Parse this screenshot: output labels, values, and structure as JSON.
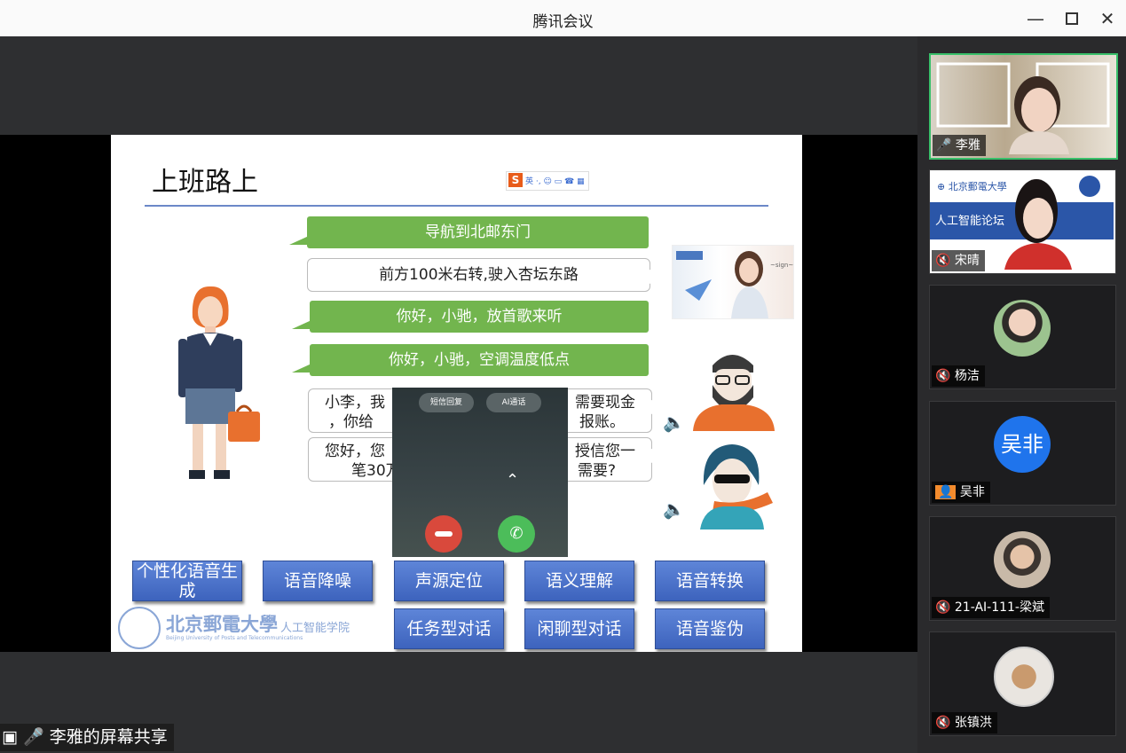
{
  "window": {
    "title": "腾讯会议"
  },
  "slide": {
    "title": "上班路上",
    "bubbles": [
      "导航到北邮东门",
      "前方100米右转,驶入杏坛东路",
      "你好，小驰，放首歌来听",
      "你好，小驰，空调温度低点",
      "小李，我",
      "需要现金",
      "，你给",
      "报账。",
      "您好，您",
      "授信您一",
      "笔30万",
      "需要?"
    ],
    "buttons": [
      "个性化语音生成",
      "语音降噪",
      "声源定位",
      "语义理解",
      "语音转换",
      "任务型对话",
      "闲聊型对话",
      "语音鉴伪"
    ],
    "university_cn": "北京郵電大學",
    "university_en": "Beijing University of Posts and Telecommunications",
    "school": "人工智能学院"
  },
  "call": {
    "sms_reply": "短信回复",
    "ai_call": "AI通话"
  },
  "share_label": "李雅的屏幕共享",
  "participants": [
    {
      "name": "李雅"
    },
    {
      "name": "宋晴",
      "banner": "人工智能论坛"
    },
    {
      "name": "杨洁"
    },
    {
      "name": "吴非",
      "avatar_text": "吴非"
    },
    {
      "name": "21-AI-111-梁斌"
    },
    {
      "name": "张镇洪"
    }
  ],
  "colors": {
    "accent_green": "#39c06a",
    "avatar_blue": "#1f74ec",
    "slide_green": "#72b54e",
    "button_blue": "#4a70c8"
  }
}
